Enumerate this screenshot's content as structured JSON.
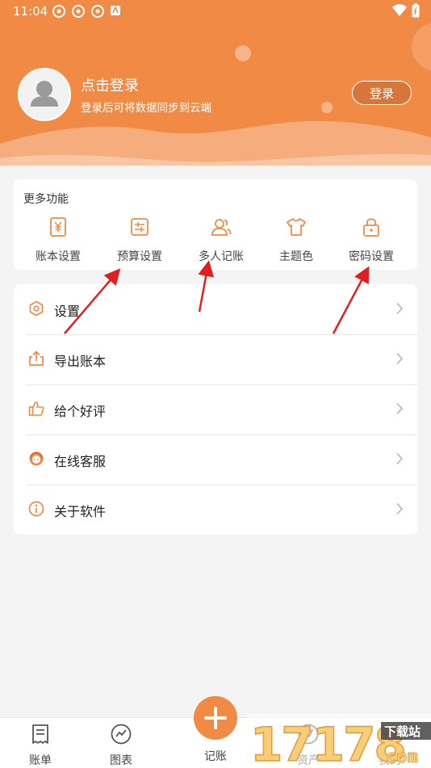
{
  "status_bar": {
    "time": "11:04"
  },
  "header": {
    "login_title": "点击登录",
    "login_subtitle": "登录后可将数据同步到云端",
    "login_button": "登录"
  },
  "more_features": {
    "title": "更多功能",
    "items": [
      {
        "label": "账本设置",
        "icon": "yen-ledger-icon"
      },
      {
        "label": "预算设置",
        "icon": "budget-icon"
      },
      {
        "label": "多人记账",
        "icon": "users-icon"
      },
      {
        "label": "主题色",
        "icon": "tshirt-icon"
      },
      {
        "label": "密码设置",
        "icon": "lock-icon"
      }
    ]
  },
  "menu": {
    "items": [
      {
        "label": "设置",
        "icon": "hexagon-settings-icon"
      },
      {
        "label": "导出账本",
        "icon": "export-icon"
      },
      {
        "label": "给个好评",
        "icon": "thumbs-up-icon"
      },
      {
        "label": "在线客服",
        "icon": "headset-icon"
      },
      {
        "label": "关于软件",
        "icon": "info-icon"
      }
    ]
  },
  "tab_bar": {
    "items": [
      {
        "label": "账单",
        "icon": "receipt-icon"
      },
      {
        "label": "图表",
        "icon": "chart-icon"
      },
      {
        "label": "记账",
        "icon": "plus-icon"
      },
      {
        "label": "资产",
        "icon": "compass-icon"
      },
      {
        "label": "我的",
        "icon": "person-icon"
      }
    ]
  },
  "watermark": {
    "text": "17178",
    "sub": "下载站",
    "domain": "com"
  },
  "colors": {
    "accent": "#f08a45",
    "annotation": "#e02020",
    "background": "#f4f4f4"
  }
}
